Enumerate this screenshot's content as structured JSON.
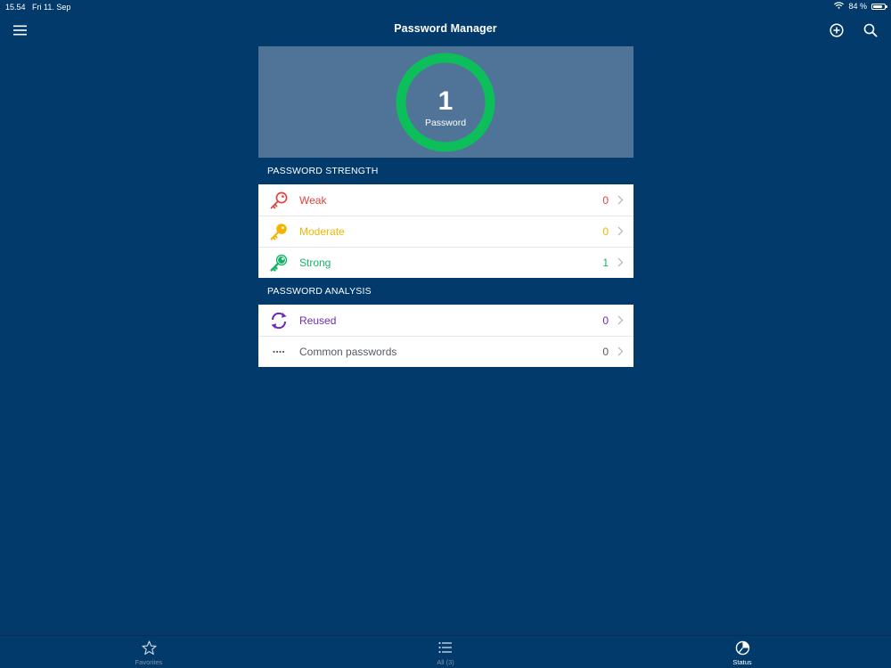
{
  "status_bar": {
    "time": "15.54",
    "date": "Fri 11. Sep",
    "battery_percent_text": "84 %",
    "battery_level": 0.84
  },
  "nav": {
    "title": "Password Manager",
    "menu_icon": "hamburger-menu-icon",
    "add_icon": "plus-circle-icon",
    "search_icon": "magnifier-icon"
  },
  "summary": {
    "count": "1",
    "label": "Password",
    "ring_color": "#0cbf5a"
  },
  "strength": {
    "header": "PASSWORD STRENGTH",
    "items": [
      {
        "label": "Weak",
        "count": "0",
        "color": "#e0443e",
        "icon": "key-icon"
      },
      {
        "label": "Moderate",
        "count": "0",
        "color": "#f4b400",
        "icon": "key-icon"
      },
      {
        "label": "Strong",
        "count": "1",
        "color": "#17b26a",
        "icon": "key-icon"
      }
    ]
  },
  "analysis": {
    "header": "PASSWORD ANALYSIS",
    "items": [
      {
        "label": "Reused",
        "count": "0",
        "color": "#6c2bb5",
        "icon": "refresh-arrows-icon"
      },
      {
        "label": "Common passwords",
        "count": "0",
        "color": "#555b62",
        "icon": "password-dots-icon"
      }
    ]
  },
  "tabs": [
    {
      "label": "Favorites",
      "icon": "star-icon",
      "active": false
    },
    {
      "label": "All (3)",
      "icon": "list-icon",
      "active": false
    },
    {
      "label": "Status",
      "icon": "status-gauge-icon",
      "active": true
    }
  ],
  "colors": {
    "background": "#013a6b",
    "summary_panel": "#4f7498",
    "chevron": "#b8bcc2"
  }
}
